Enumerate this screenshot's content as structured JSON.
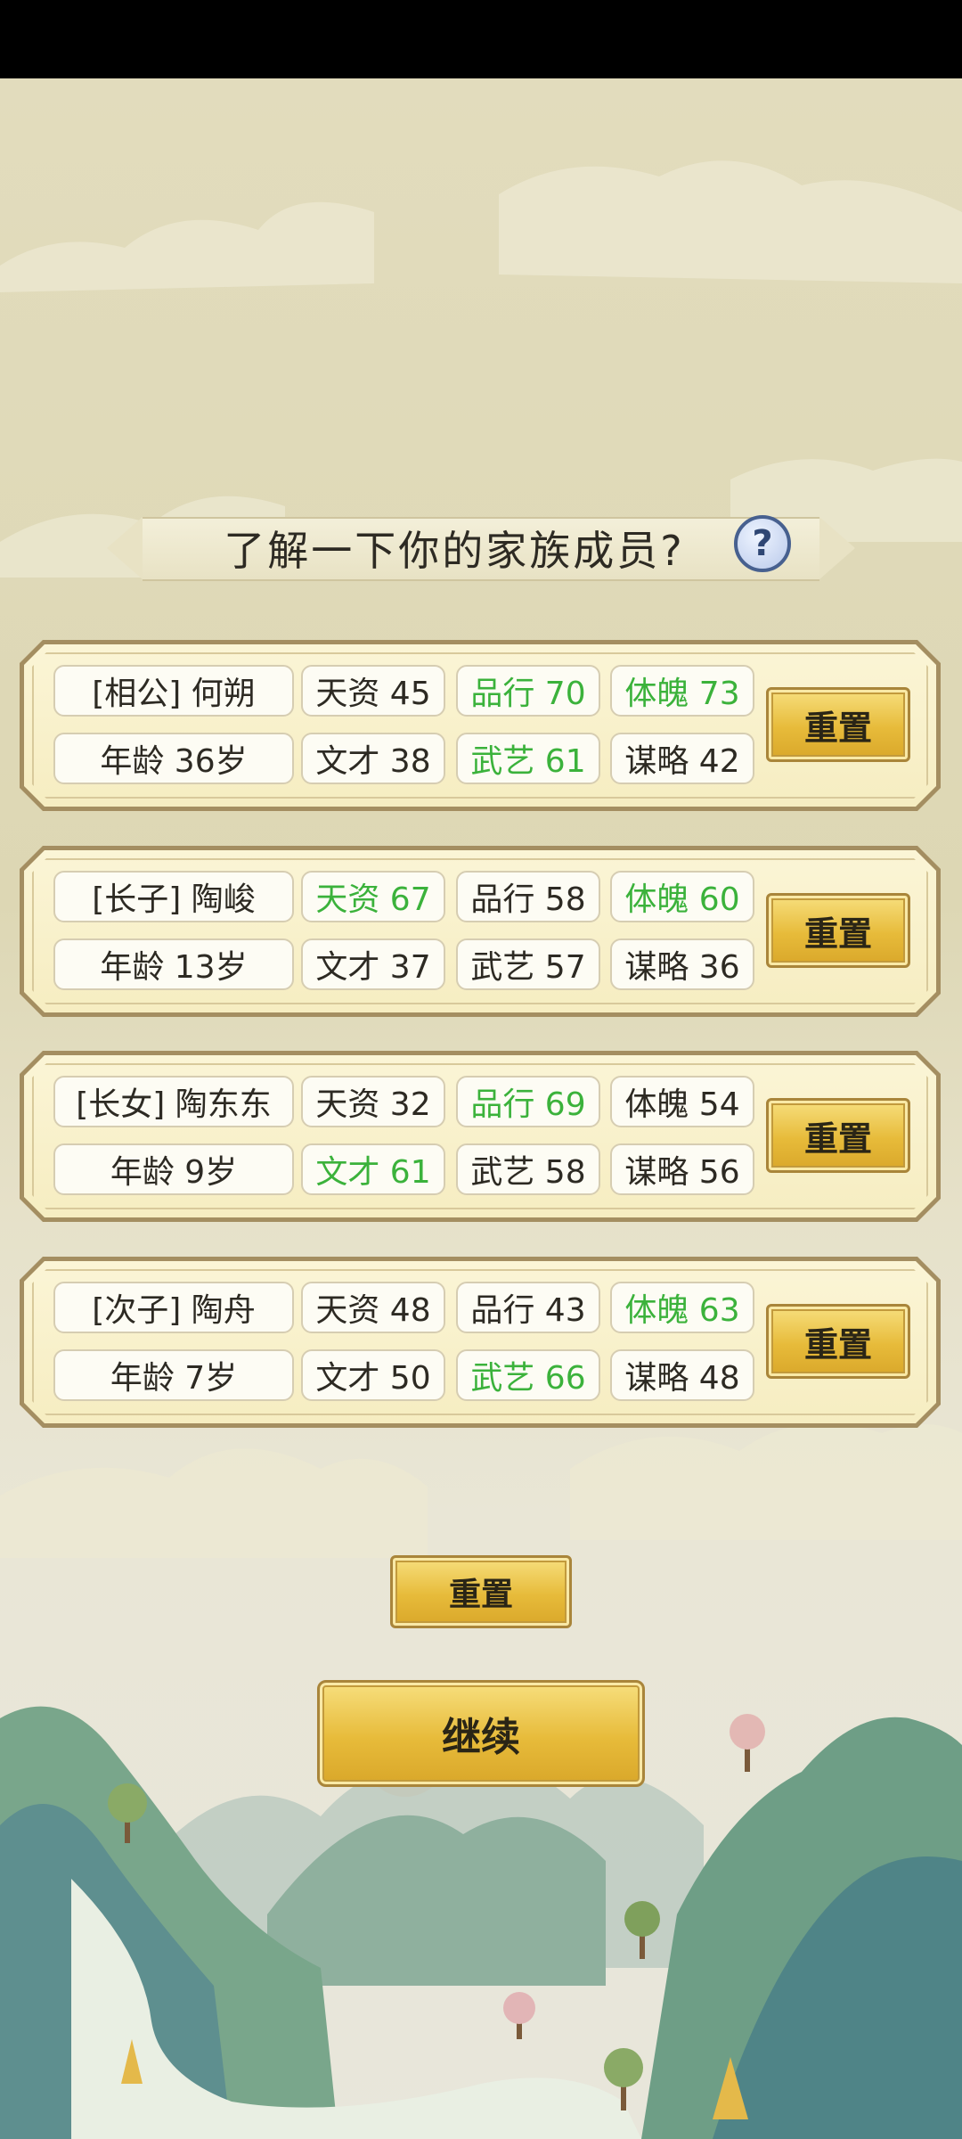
{
  "title": "了解一下你的家族成员?",
  "help_icon": "?",
  "members": [
    {
      "name": "[相公] 何朔",
      "age": "年龄 36岁",
      "stats_row1": [
        {
          "text": "天资 45",
          "good": false
        },
        {
          "text": "品行 70",
          "good": true
        },
        {
          "text": "体魄 73",
          "good": true
        }
      ],
      "stats_row2": [
        {
          "text": "文才 38",
          "good": false
        },
        {
          "text": "武艺 61",
          "good": true
        },
        {
          "text": "谋略 42",
          "good": false
        }
      ],
      "reset_label": "重置"
    },
    {
      "name": "[长子] 陶峻",
      "age": "年龄 13岁",
      "stats_row1": [
        {
          "text": "天资 67",
          "good": true
        },
        {
          "text": "品行 58",
          "good": false
        },
        {
          "text": "体魄 60",
          "good": true
        }
      ],
      "stats_row2": [
        {
          "text": "文才 37",
          "good": false
        },
        {
          "text": "武艺 57",
          "good": false
        },
        {
          "text": "谋略 36",
          "good": false
        }
      ],
      "reset_label": "重置"
    },
    {
      "name": "[长女] 陶东东",
      "age": "年龄 9岁",
      "stats_row1": [
        {
          "text": "天资 32",
          "good": false
        },
        {
          "text": "品行 69",
          "good": true
        },
        {
          "text": "体魄 54",
          "good": false
        }
      ],
      "stats_row2": [
        {
          "text": "文才 61",
          "good": true
        },
        {
          "text": "武艺 58",
          "good": false
        },
        {
          "text": "谋略 56",
          "good": false
        }
      ],
      "reset_label": "重置"
    },
    {
      "name": "[次子] 陶舟",
      "age": "年龄 7岁",
      "stats_row1": [
        {
          "text": "天资 48",
          "good": false
        },
        {
          "text": "品行 43",
          "good": false
        },
        {
          "text": "体魄 63",
          "good": true
        }
      ],
      "stats_row2": [
        {
          "text": "文才 50",
          "good": false
        },
        {
          "text": "武艺 66",
          "good": true
        },
        {
          "text": "谋略 48",
          "good": false
        }
      ],
      "reset_label": "重置"
    }
  ],
  "reset_all_label": "重置",
  "continue_label": "继续",
  "colors": {
    "highlight_stat": "#3bb23b",
    "normal_text": "#2d2a23",
    "gold_button": "#e7bb3a",
    "panel_bg": "#f6edc1"
  }
}
